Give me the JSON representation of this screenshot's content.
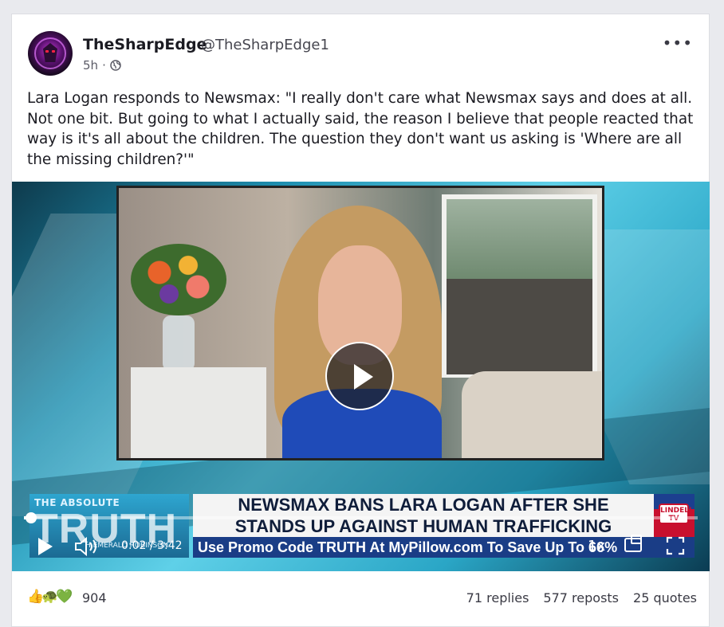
{
  "post": {
    "author_name": "TheSharpEdge",
    "author_handle": "@TheSharpEdge1",
    "time_ago": "5h",
    "separator": "·",
    "more_label": "•••",
    "text": "Lara Logan responds to Newsmax: \"I really don't care what Newsmax says and does at all. Not one bit. But going to what I actually said, the reason I believe that people reacted that way is it's all about the children. The question they don't want us asking is 'Where are all the missing children?'\""
  },
  "video": {
    "overlay_small": "THE ABSOLUTE",
    "overlay_big": "TRUTH",
    "overlay_sub": "H EMERALD ROBINSON",
    "headline_1": "NEWSMAX BANS LARA LOGAN AFTER SHE",
    "headline_2": "STANDS UP AGAINST HUMAN TRAFFICKING",
    "promo": "Use Promo Code TRUTH At MyPillow.com To Save Up To 66%",
    "logo_text": "LINDELL TV",
    "time_current": "0:02",
    "time_sep": "/",
    "time_total": "3:42",
    "progress": 0.009,
    "speed": "1x"
  },
  "footer": {
    "reactions": "👍🐢💚",
    "reaction_count": "904",
    "replies": "71 replies",
    "reposts": "577 reposts",
    "quotes": "25 quotes"
  },
  "colors": {
    "headline": "#0f1d3a",
    "promo_bg": "#1a3d86",
    "accent_red": "#c8102e"
  }
}
